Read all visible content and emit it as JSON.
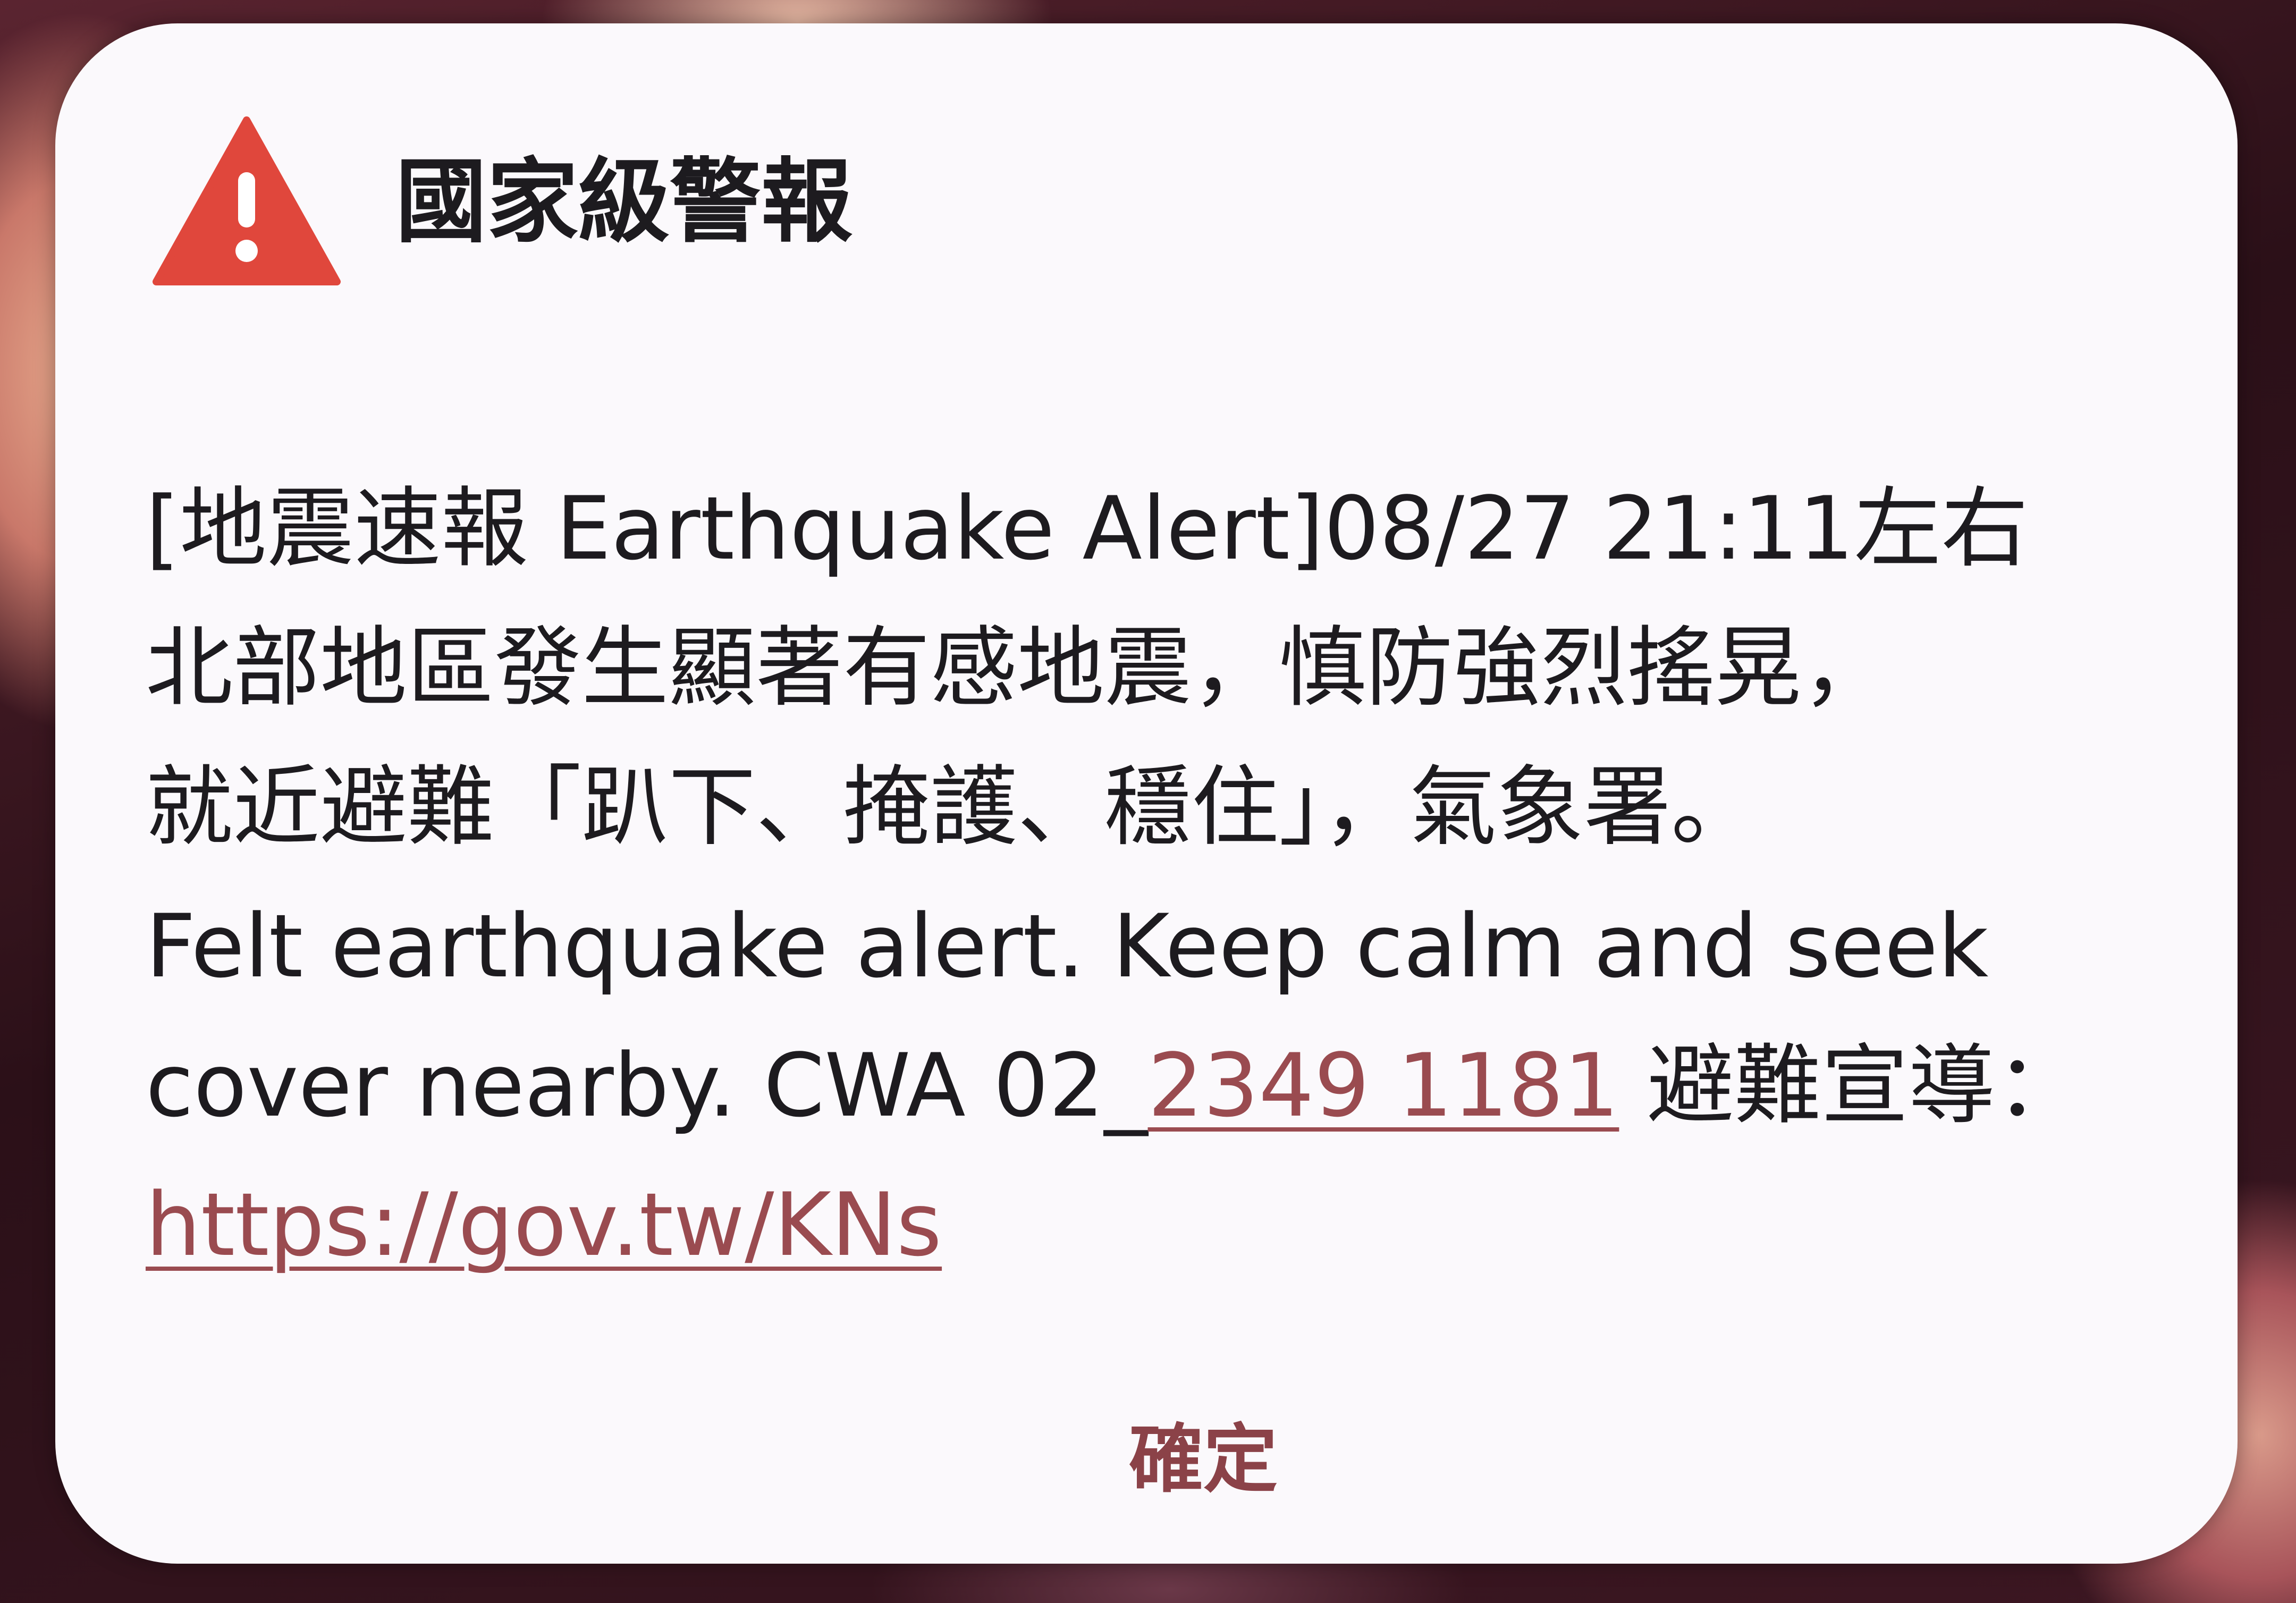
{
  "colors": {
    "dialog_bg": "#fbf9fc",
    "warning_red": "#e0473c",
    "link": "#9a4b50",
    "button_text": "#8b4248",
    "text": "#1d1b1f"
  },
  "alert": {
    "icon": "warning-triangle-icon",
    "title": "國家級警報",
    "body": {
      "line1": "[地震速報 Earthquake Alert]08/27 21:11左右",
      "line2": "北部地區發生顯著有感地震，慎防強烈搖晃，",
      "line3": "就近避難「趴下、掩護、穩住」，氣象署。",
      "line4": "Felt earthquake alert. Keep calm and seek",
      "line5_prefix": "cover nearby. CWA 02_",
      "phone": "2349 1181",
      "line5_suffix": " 避難宣導：",
      "url": "https://gov.tw/KNs"
    },
    "confirm_label": "確定"
  }
}
